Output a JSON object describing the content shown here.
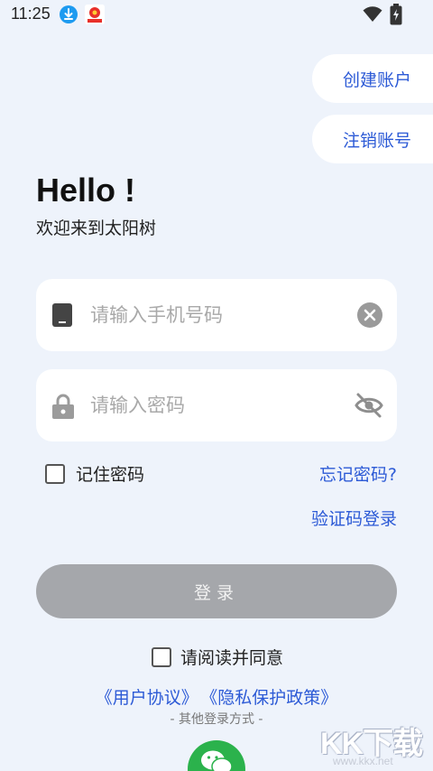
{
  "status_bar": {
    "time": "11:25",
    "icons": [
      "download-icon",
      "app-notification-icon",
      "wifi-icon",
      "battery-charging-icon"
    ]
  },
  "header": {
    "create_account": "创建账户",
    "cancel_account": "注销账号"
  },
  "greeting": {
    "title": "Hello !",
    "subtitle": "欢迎来到太阳树"
  },
  "form": {
    "phone": {
      "placeholder": "请输入手机号码",
      "value": "",
      "left_icon": "phone-icon",
      "right_icon": "clear-icon"
    },
    "password": {
      "placeholder": "请输入密码",
      "value": "",
      "left_icon": "lock-icon",
      "right_icon": "eye-off-icon"
    },
    "remember_label": "记住密码",
    "remember_checked": false,
    "forgot_label": "忘记密码?",
    "sms_login_label": "验证码登录",
    "login_label": "登录",
    "agree_label": "请阅读并同意",
    "agree_checked": false,
    "user_agreement": "《用户协议》",
    "privacy_policy": "《隐私保护政策》",
    "other_login": "- 其他登录方式 -"
  },
  "social": {
    "wechat_icon": "wechat-icon"
  },
  "watermark": {
    "brand": "KK下载",
    "url": "www.kkx.net"
  },
  "colors": {
    "background": "#eef3fb",
    "accent": "#2c5ad6",
    "login_button_disabled": "#a5a7ab",
    "wechat_green": "#2bb24c"
  }
}
